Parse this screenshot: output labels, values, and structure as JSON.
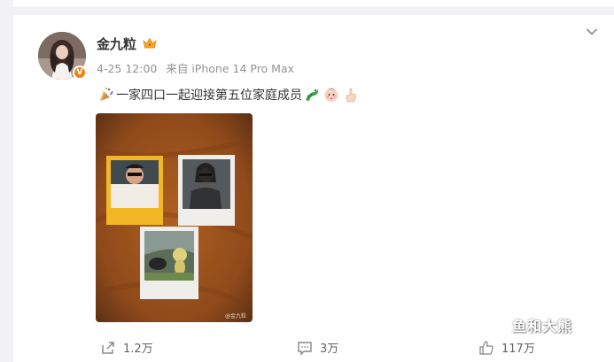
{
  "post": {
    "author": "金九粒",
    "verified_badge": "V",
    "time": "4-25 12:00",
    "source": "来自 iPhone 14 Pro Max",
    "text": "一家四口一起迎接第五位家庭成员",
    "emojis": [
      "party-popper-icon",
      "dragon-icon",
      "baby-face-icon",
      "pointing-hand-icon"
    ],
    "image_caption": "@金九粒"
  },
  "actions": {
    "repost_count": "1.2万",
    "comment_count": "3万",
    "like_count": "117万"
  },
  "watermark": "鱼和大熊",
  "colors": {
    "page_bg": "#f2f2f5",
    "card_bg": "#ffffff",
    "text_primary": "#333333",
    "text_meta": "#939393",
    "verified": "#e8841a",
    "photo_bg": "#a0521f"
  }
}
